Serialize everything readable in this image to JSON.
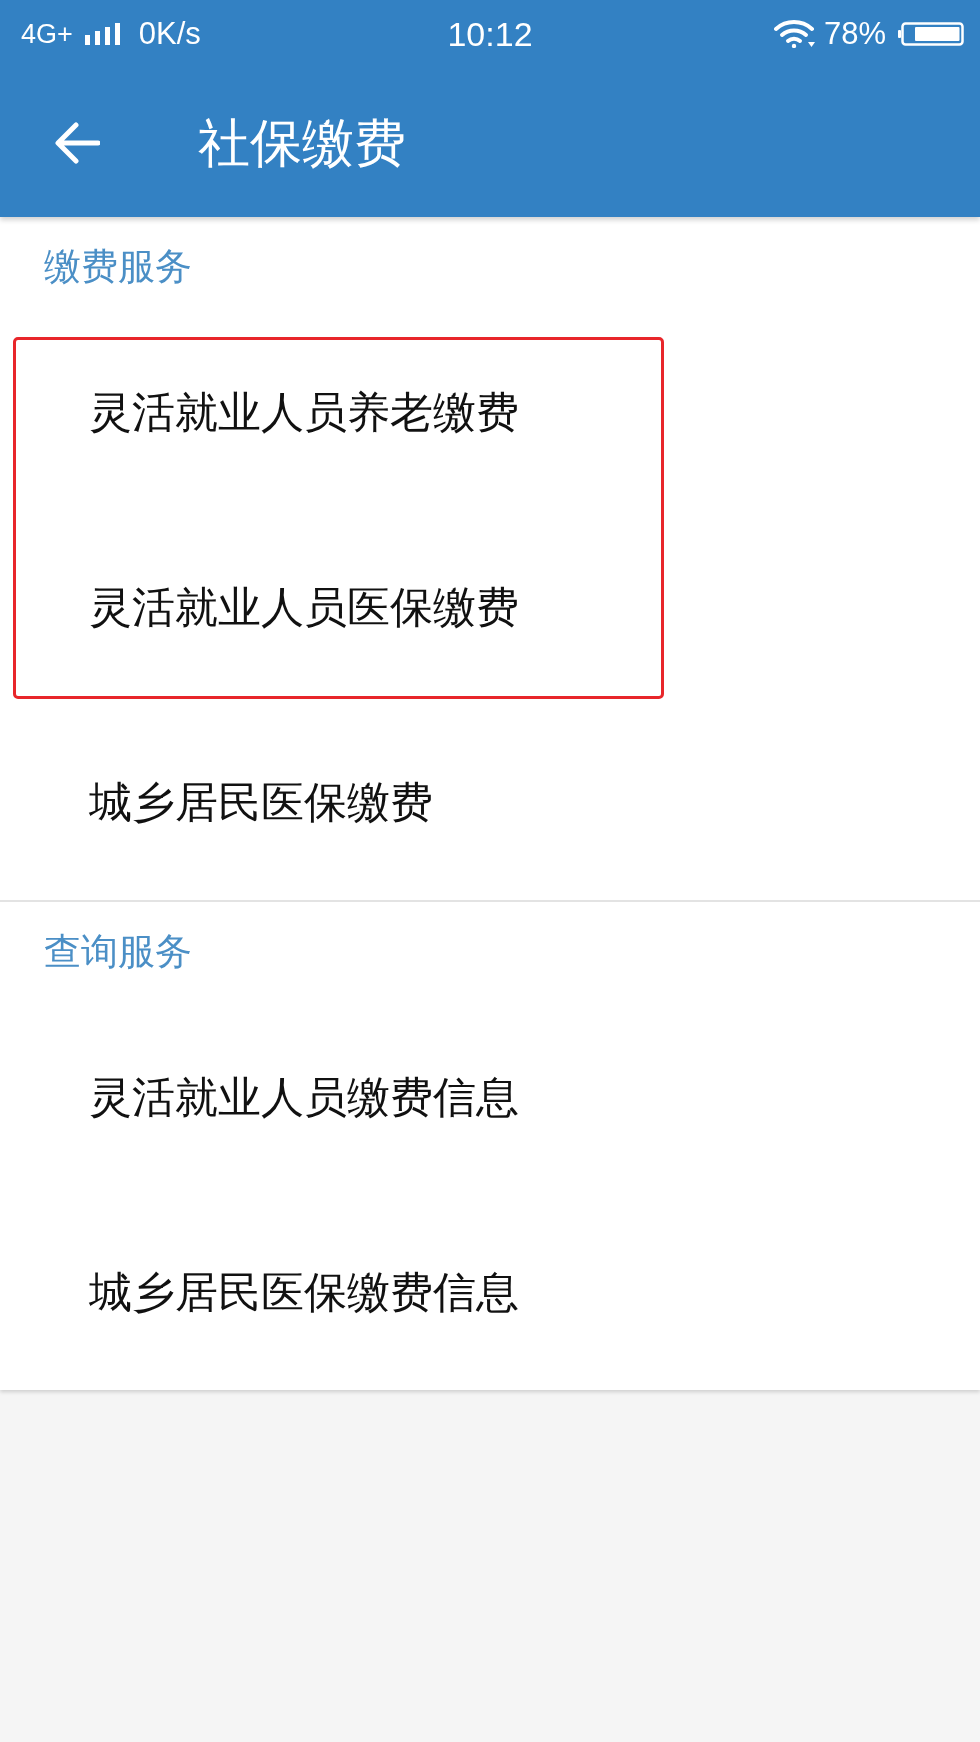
{
  "status_bar": {
    "network": "4G+",
    "speed": "0K/s",
    "time": "10:12",
    "battery": "78%"
  },
  "app_bar": {
    "title": "社保缴费"
  },
  "sections": [
    {
      "title": "缴费服务",
      "items": [
        {
          "label": "灵活就业人员养老缴费",
          "highlighted": true
        },
        {
          "label": "灵活就业人员医保缴费",
          "highlighted": true
        },
        {
          "label": "城乡居民医保缴费",
          "highlighted": false
        }
      ]
    },
    {
      "title": "查询服务",
      "items": [
        {
          "label": "灵活就业人员缴费信息",
          "highlighted": false
        },
        {
          "label": "城乡居民医保缴费信息",
          "highlighted": false
        }
      ]
    }
  ]
}
